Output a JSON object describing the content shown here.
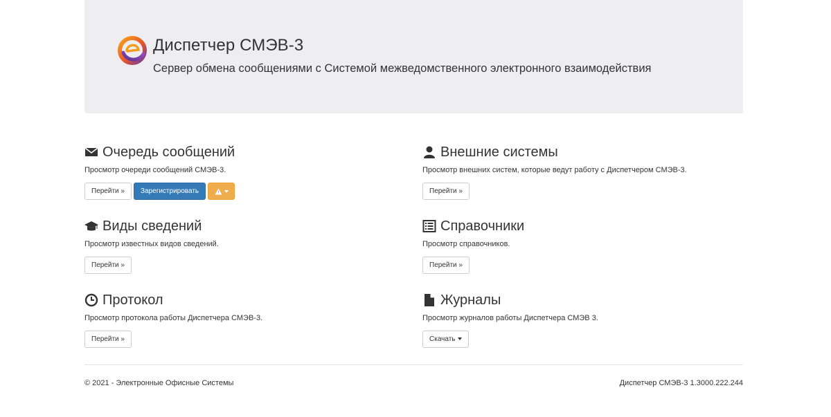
{
  "header": {
    "title": "Диспетчер СМЭВ-3",
    "subtitle": "Сервер обмена сообщениями с Системой межведомственного электронного взаимодействия"
  },
  "sections": [
    {
      "title": "Очередь сообщений",
      "icon": "envelope-icon",
      "description": "Просмотр очереди сообщений СМЭВ-3.",
      "buttons": {
        "go": "Перейти »",
        "register": "Зарегистрировать"
      }
    },
    {
      "title": "Внешние системы",
      "icon": "user-icon",
      "description": "Просмотр внешних систем, которые ведут работу с Диспетчером СМЭВ-3.",
      "buttons": {
        "go": "Перейти »"
      }
    },
    {
      "title": "Виды сведений",
      "icon": "graduation-cap-icon",
      "description": "Просмотр известных видов сведений.",
      "buttons": {
        "go": "Перейти »"
      }
    },
    {
      "title": "Справочники",
      "icon": "list-alt-icon",
      "description": "Просмотр справочников.",
      "buttons": {
        "go": "Перейти »"
      }
    },
    {
      "title": "Протокол",
      "icon": "clock-icon",
      "description": "Просмотр протокола работы Диспетчера СМЭВ-3.",
      "buttons": {
        "go": "Перейти »"
      }
    },
    {
      "title": "Журналы",
      "icon": "file-icon",
      "description": "Просмотр журналов работы Диспетчера СМЭВ 3.",
      "buttons": {
        "download": "Скачать"
      }
    }
  ],
  "footer": {
    "copyright": "© 2021 - Электронные Офисные Системы",
    "version": "Диспетчер СМЭВ-3 1.3000.222.244"
  },
  "colors": {
    "primary": "#337ab7",
    "warning": "#f0ad4e",
    "jumbotron": "#eeeef0"
  }
}
